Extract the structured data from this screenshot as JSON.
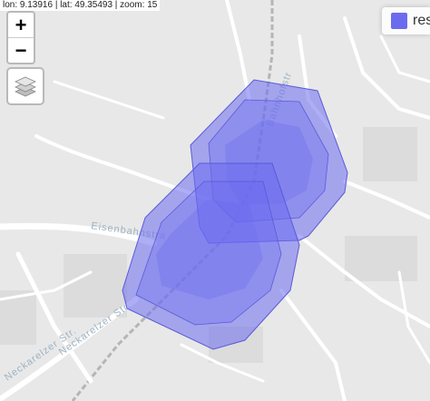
{
  "status": {
    "coordinates": "lon: 9.13916 | lat: 49.35493 | zoom: 15"
  },
  "controls": {
    "zoom_in_label": "+",
    "zoom_out_label": "−",
    "layers_icon": "layers-icon"
  },
  "legend": {
    "label": "res",
    "color": "#6b6bf0"
  },
  "map": {
    "street_labels": [
      {
        "text": "Eisenbahnstraße",
        "visible_text": "Eisenbahnstra"
      },
      {
        "text": "Neckarelzer Str.",
        "visible_text": "Neckarelzer Str."
      },
      {
        "text": "Neckarelzer Str.",
        "visible_text": "Neckarelzer Str."
      },
      {
        "text": "Bahnhofstraße",
        "visible_text": "Bahnhofstr"
      }
    ],
    "colors": {
      "background": "#e8e8e8",
      "road": "#ffffff",
      "railway": "#b5b5b5",
      "isochrone": "#6b6bf0"
    }
  }
}
